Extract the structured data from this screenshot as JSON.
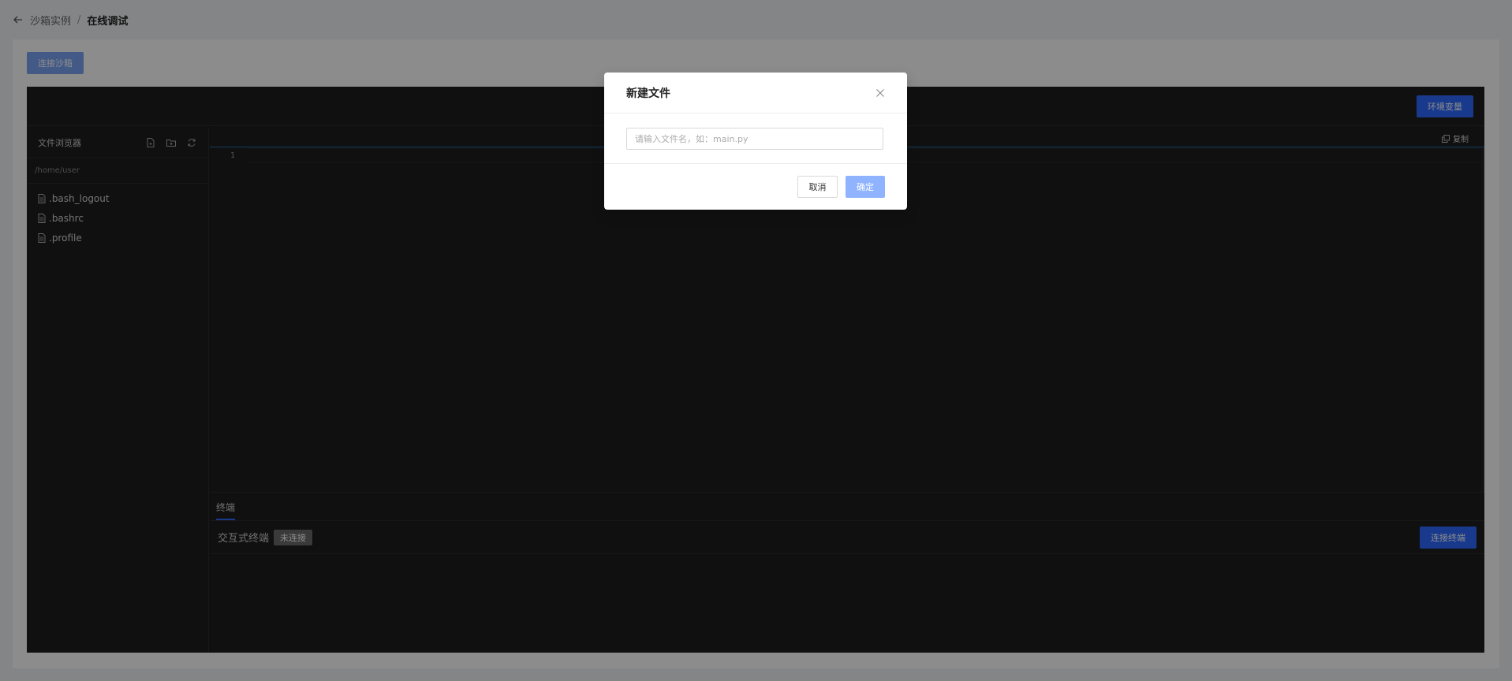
{
  "breadcrumb": {
    "back_icon": "arrow-left-icon",
    "parent": "沙箱实例",
    "separator": "/",
    "current": "在线调试"
  },
  "toolbar": {
    "connect_sandbox_label": "连接沙箱",
    "env_vars_label": "环境变量"
  },
  "sidebar": {
    "title": "文件浏览器",
    "icons": [
      "new-file-icon",
      "new-folder-icon",
      "refresh-icon"
    ],
    "path": "/home/user",
    "files": [
      {
        "name": ".bash_logout"
      },
      {
        "name": ".bashrc"
      },
      {
        "name": ".profile"
      }
    ]
  },
  "editor": {
    "copy_label": "复制",
    "line_number": "1"
  },
  "terminal": {
    "tab_label": "终端",
    "title": "交互式终端",
    "status": "未连接",
    "connect_label": "连接终端"
  },
  "modal": {
    "title": "新建文件",
    "input_value": "",
    "input_placeholder": "请输入文件名，如：main.py",
    "cancel_label": "取消",
    "ok_label": "确定"
  },
  "colors": {
    "primary": "#2f6bff",
    "primary_disabled": "#8fb3ff",
    "ide_background": "#1e1e1e"
  }
}
